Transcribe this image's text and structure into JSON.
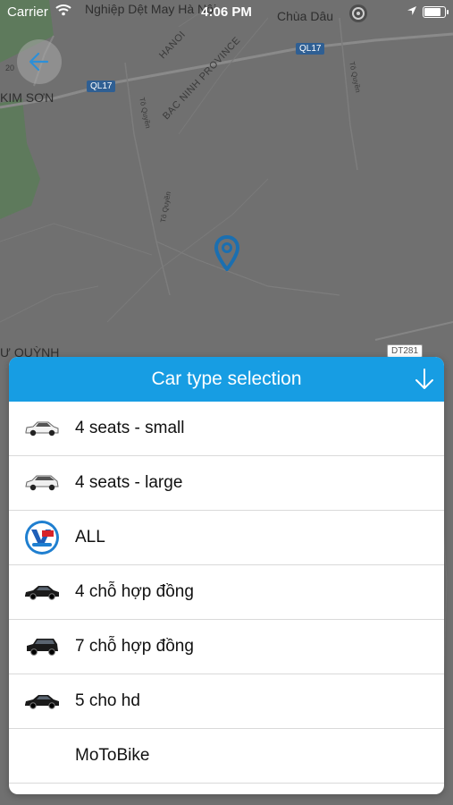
{
  "status_bar": {
    "carrier": "Carrier",
    "time": "4:06 PM",
    "battery_level": 0.95
  },
  "map": {
    "labels": {
      "factory": "Nghiệp Dệt May Hà Nội",
      "pagoda": "Chùa Dâu",
      "hanoi": "HANOI",
      "province": "BAC NINH PROVINCE",
      "kim_son": "KIM SƠN",
      "quynh": "Ư QUỲNH",
      "road_to_quyen_1": "Tô Quyền",
      "road_to_quyen_2": "Tô Quyền",
      "road_to_quyen_3": "Tô Quyền",
      "number_20": "20"
    },
    "shields": {
      "ql17_left": "QL17",
      "ql17_right": "QL17",
      "dt281": "DT281"
    }
  },
  "sheet": {
    "title": "Car type selection",
    "header_color": "#179de3",
    "items": [
      {
        "label": "4 seats - small",
        "icon": "white-sedan-icon"
      },
      {
        "label": "4 seats - large",
        "icon": "white-hatchback-icon"
      },
      {
        "label": "ALL",
        "icon": "brand-logo-icon"
      },
      {
        "label": "4 chỗ hợp đồng",
        "icon": "black-sedan-icon"
      },
      {
        "label": "7 chỗ hợp đồng",
        "icon": "black-suv-icon"
      },
      {
        "label": "5 cho hd",
        "icon": "black-sedan-icon"
      },
      {
        "label": "MoToBike",
        "icon": ""
      }
    ]
  },
  "colors": {
    "accent": "#179de3",
    "pin": "#1b6fb0"
  }
}
